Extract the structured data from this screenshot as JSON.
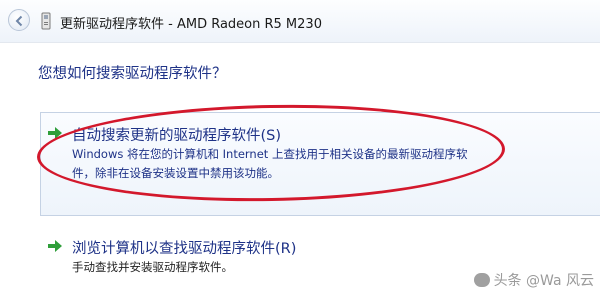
{
  "window": {
    "title": "更新驱动程序软件 - AMD Radeon R5 M230"
  },
  "heading": "您想如何搜索驱动程序软件？",
  "options": [
    {
      "title": "自动搜索更新的驱动程序软件(S)",
      "desc_line1": "Windows 将在您的计算机和 Internet 上查找用于相关设备的最新驱动程序软",
      "desc_line2": "件，除非在设备安装设置中禁用该功能。"
    },
    {
      "title": "浏览计算机以查找驱动程序软件(R)",
      "desc_line1": "手动查找并安装驱动程序软件。"
    }
  ],
  "watermark": "头条 @Wa 风云",
  "colors": {
    "link_blue": "#1e3287",
    "arrow_green": "#2f9e3a",
    "annotation_red": "#d3182c"
  },
  "icons": [
    "back-arrow-icon",
    "device-icon",
    "green-arrow-icon"
  ]
}
